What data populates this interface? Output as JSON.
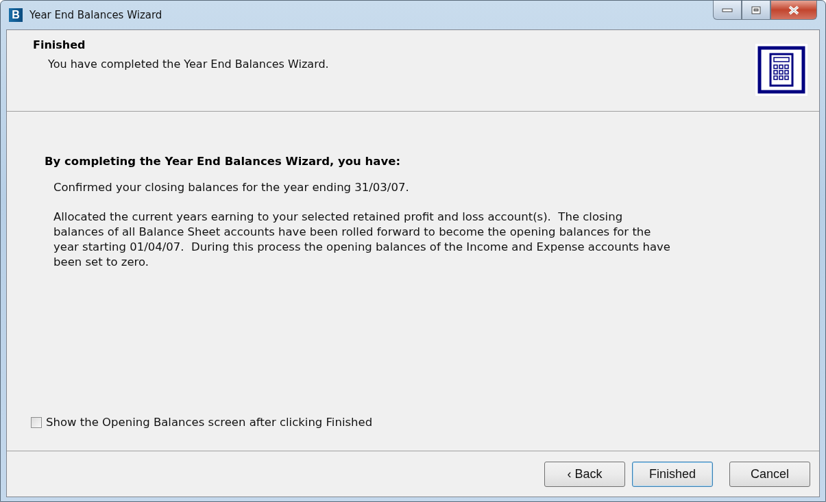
{
  "window": {
    "title": "Year End Balances Wizard",
    "app_letter": "B"
  },
  "header": {
    "title": "Finished",
    "subtitle": "You have completed the Year End Balances Wizard."
  },
  "body": {
    "heading": "By completing the Year End Balances Wizard, you have:",
    "paragraphs": [
      "Confirmed your closing balances for the year ending 31/03/07.",
      "Allocated the current years earning to your selected retained profit and loss account(s).  The closing balances of all Balance Sheet accounts have been rolled forward to become the opening balances for the year starting 01/04/07.  During this process the opening balances of the Income and Expense accounts have been set to zero."
    ]
  },
  "checkbox": {
    "label": "Show the Opening Balances screen after clicking Finished",
    "checked": false
  },
  "buttons": [
    {
      "label": "‹ Back",
      "default": false
    },
    {
      "label": "Finished",
      "default": true
    },
    {
      "label": "Cancel",
      "default": false
    }
  ]
}
